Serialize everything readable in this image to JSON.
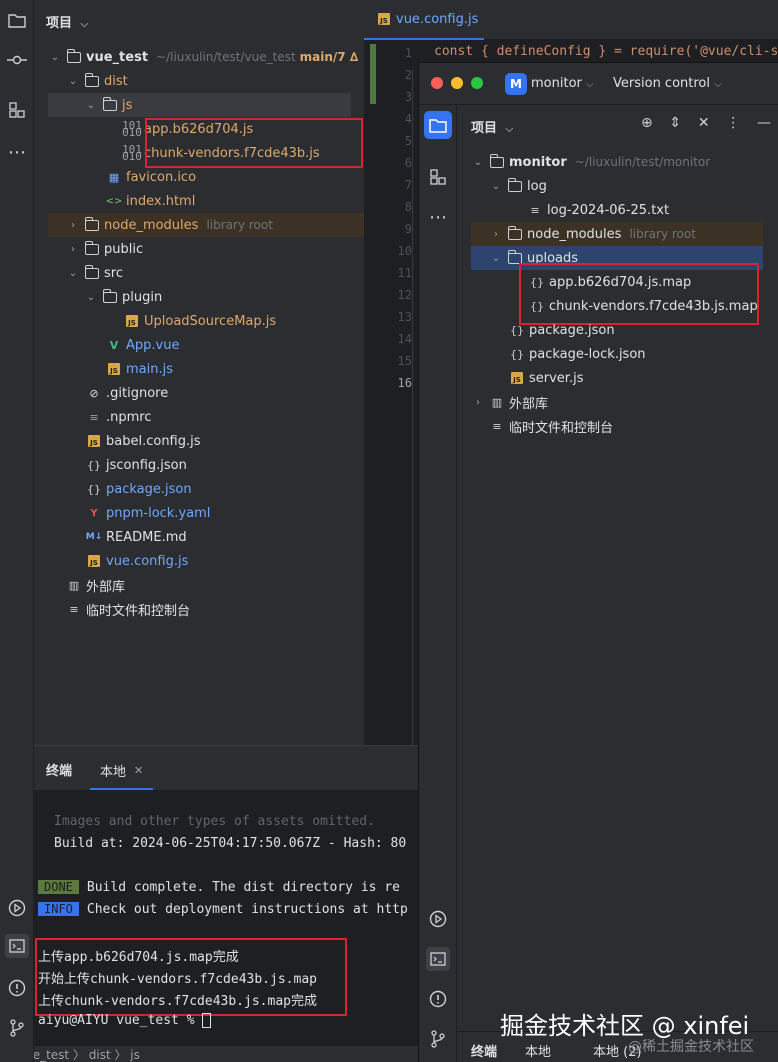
{
  "left_panel": {
    "title": "项目",
    "root": {
      "name": "vue_test",
      "path": "~/liuxulin/test/vue_test",
      "branch": "main/7 ∆"
    },
    "items": [
      {
        "name": "dist",
        "extra": ""
      },
      {
        "name": "js",
        "extra": ""
      },
      {
        "name": "app.b626d704.js",
        "extra": ""
      },
      {
        "name": "chunk-vendors.f7cde43b.js",
        "extra": ""
      },
      {
        "name": "favicon.ico",
        "extra": ""
      },
      {
        "name": "index.html",
        "extra": ""
      },
      {
        "name": "node_modules",
        "extra": "library root"
      },
      {
        "name": "public",
        "extra": ""
      },
      {
        "name": "src",
        "extra": ""
      },
      {
        "name": "plugin",
        "extra": ""
      },
      {
        "name": "UploadSourceMap.js",
        "extra": ""
      },
      {
        "name": "App.vue",
        "extra": ""
      },
      {
        "name": "main.js",
        "extra": ""
      },
      {
        "name": ".gitignore",
        "extra": ""
      },
      {
        "name": ".npmrc",
        "extra": ""
      },
      {
        "name": "babel.config.js",
        "extra": ""
      },
      {
        "name": "jsconfig.json",
        "extra": ""
      },
      {
        "name": "package.json",
        "extra": ""
      },
      {
        "name": "pnpm-lock.yaml",
        "extra": ""
      },
      {
        "name": "README.md",
        "extra": ""
      },
      {
        "name": "vue.config.js",
        "extra": ""
      },
      {
        "name": "外部库",
        "extra": ""
      },
      {
        "name": "临时文件和控制台",
        "extra": ""
      }
    ]
  },
  "editor": {
    "tab": "vue.config.js",
    "line1": "const { defineConfig } = require('@vue/cli-se",
    "line_numbers": [
      "1",
      "2",
      "3",
      "4",
      "5",
      "6",
      "7",
      "8",
      "9",
      "10",
      "11",
      "12",
      "13",
      "14",
      "15",
      "16"
    ]
  },
  "terminal": {
    "title": "终端",
    "tab": "本地",
    "lines": [
      "Images and other types of assets omitted.",
      "Build at: 2024-06-25T04:17:50.067Z - Hash: 80",
      "Build complete. The dist directory is re",
      "Check out deployment instructions at http",
      "上传app.b626d704.js.map完成",
      "开始上传chunk-vendors.f7cde43b.js.map",
      "上传chunk-vendors.f7cde43b.js.map完成",
      "aiyu@AIYU vue_test % "
    ],
    "badge_done": "DONE",
    "badge_info": "INFO"
  },
  "breadcrumb": "vue_test 〉 dist 〉 js",
  "right_window": {
    "project_badge": "M",
    "project_name": "monitor",
    "vcs": "Version control",
    "panel_title": "项目",
    "root": {
      "name": "monitor",
      "path": "~/liuxulin/test/monitor"
    },
    "items": [
      {
        "name": "log",
        "extra": ""
      },
      {
        "name": "log-2024-06-25.txt",
        "extra": ""
      },
      {
        "name": "node_modules",
        "extra": "library root"
      },
      {
        "name": "uploads",
        "extra": ""
      },
      {
        "name": "app.b626d704.js.map",
        "extra": ""
      },
      {
        "name": "chunk-vendors.f7cde43b.js.map",
        "extra": ""
      },
      {
        "name": "package.json",
        "extra": ""
      },
      {
        "name": "package-lock.json",
        "extra": ""
      },
      {
        "name": "server.js",
        "extra": ""
      },
      {
        "name": "外部库",
        "extra": ""
      },
      {
        "name": "临时文件和控制台",
        "extra": ""
      }
    ],
    "bottom_tabs": [
      "终端",
      "本地",
      "本地 (2)"
    ]
  },
  "watermark": {
    "main": "掘金技术社区 @ xinfei",
    "sub": "@稀土掘金技术社区"
  },
  "colors": {
    "red_box": "#d9242e",
    "accent_blue": "#3574f0",
    "js_yellow": "#d9a743"
  }
}
